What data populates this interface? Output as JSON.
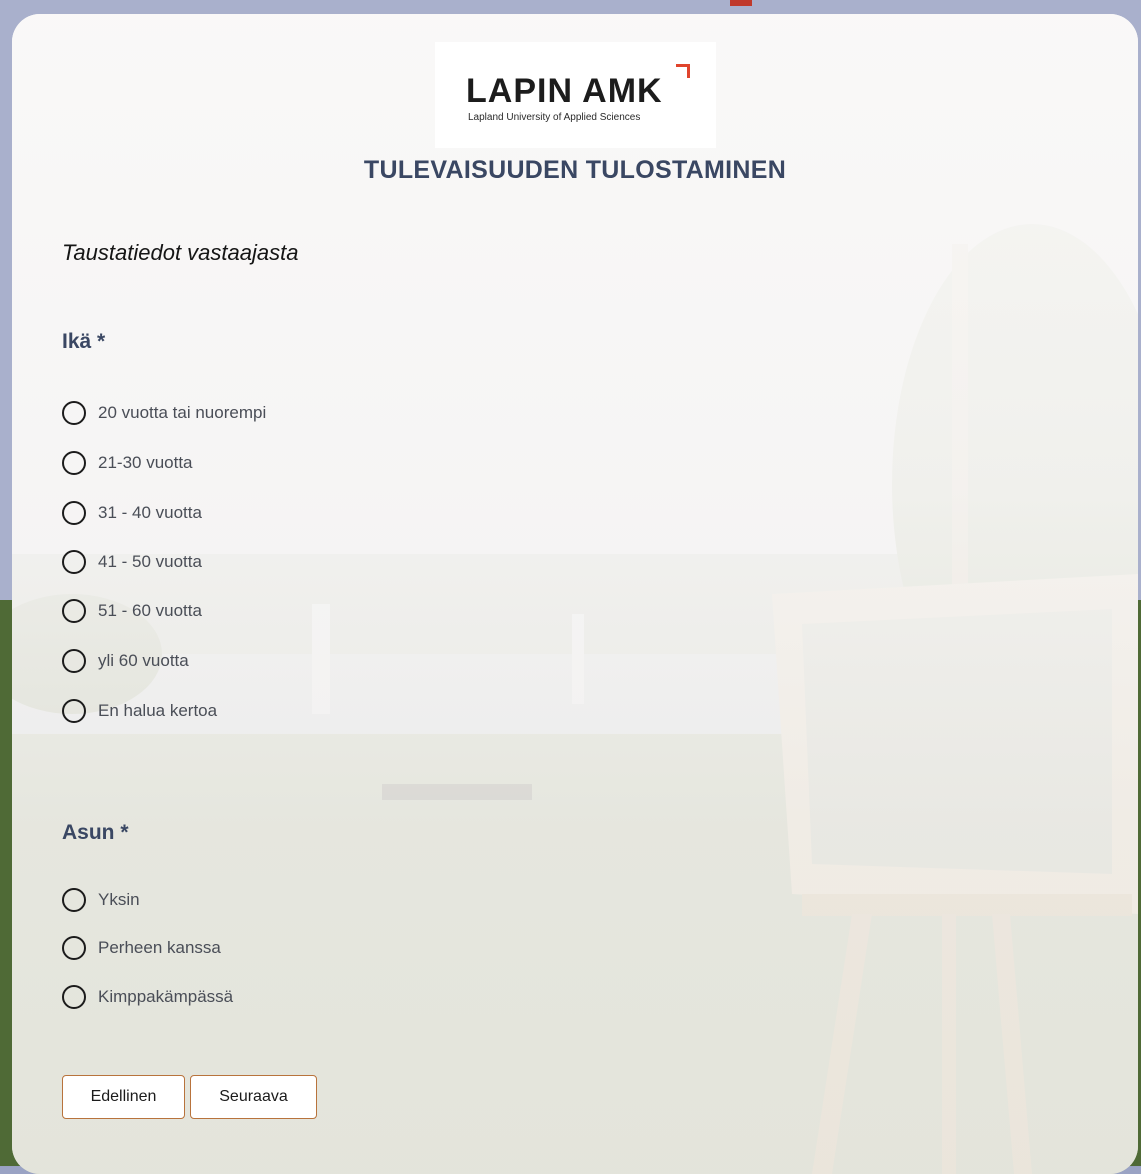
{
  "logo": {
    "name": "LAPIN AMK",
    "tagline": "Lapland University of Applied Sciences",
    "accent": "#e0442c"
  },
  "title": "TULEVAISUUDEN TULOSTAMINEN",
  "section": "Taustatiedot vastaajasta",
  "questions": [
    {
      "label": "Ikä *",
      "options": [
        "20 vuotta tai nuorempi",
        "21-30 vuotta",
        "31 - 40 vuotta",
        "41 - 50 vuotta",
        "51 - 60 vuotta",
        "yli 60 vuotta",
        "En halua kertoa"
      ]
    },
    {
      "label": "Asun *",
      "options": [
        "Yksin",
        "Perheen kanssa",
        "Kimppakämpässä"
      ]
    }
  ],
  "buttons": {
    "previous": "Edellinen",
    "next": "Seuraava"
  },
  "colors": {
    "heading": "#3a4763",
    "button_border": "#b8733c"
  }
}
